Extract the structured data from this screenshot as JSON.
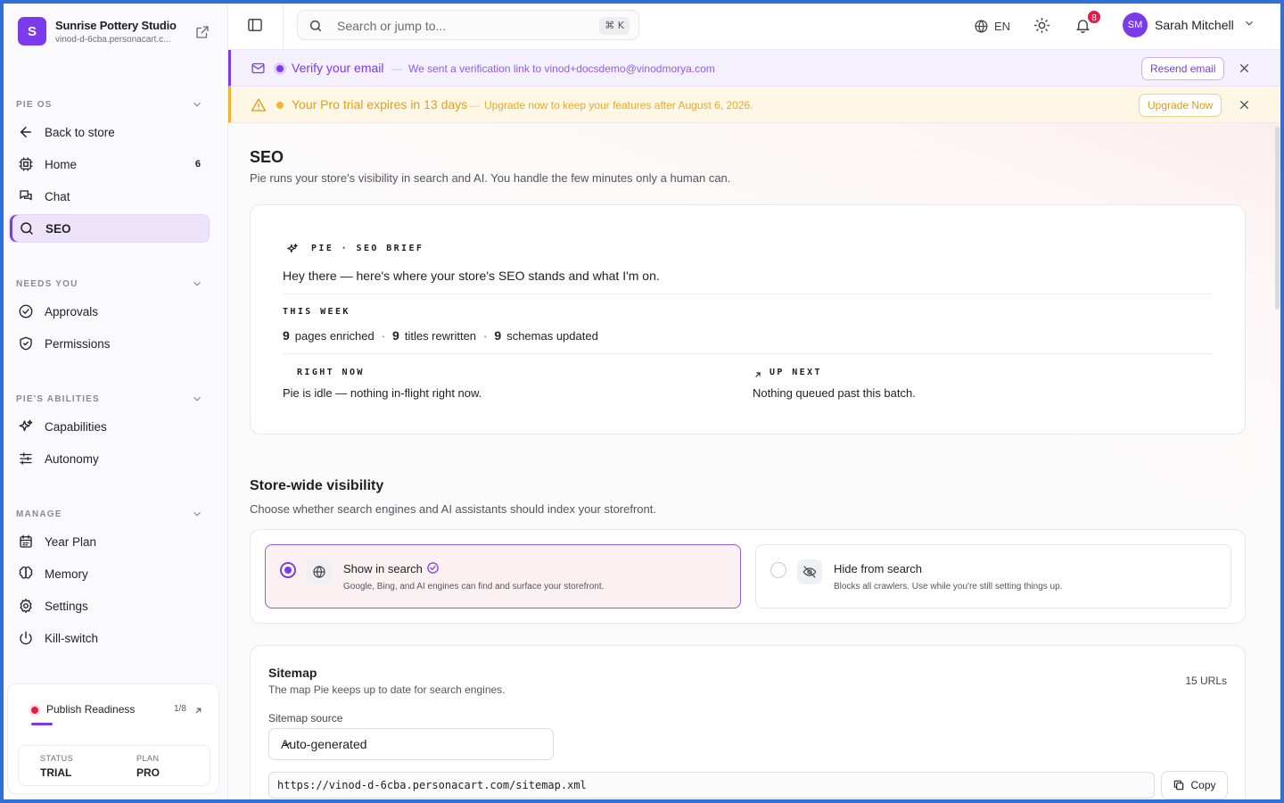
{
  "brand": {
    "initial": "S",
    "name": "Sunrise Pottery Studio",
    "url": "vinod-d-6cba.personacart.c..."
  },
  "sidebar": {
    "sections": [
      {
        "label": "PIE OS"
      },
      {
        "label": "NEEDS YOU"
      },
      {
        "label": "PIE'S ABILITIES"
      },
      {
        "label": "MANAGE"
      }
    ],
    "items": [
      {
        "label": "Back to store",
        "icon": "arrow-left-icon"
      },
      {
        "label": "Home",
        "icon": "cpu-icon",
        "count": "6"
      },
      {
        "label": "Chat",
        "icon": "chat-icon"
      },
      {
        "label": "SEO",
        "icon": "search-icon",
        "active": true
      },
      {
        "label": "Approvals",
        "icon": "check-circle-icon"
      },
      {
        "label": "Permissions",
        "icon": "shield-check-icon"
      },
      {
        "label": "Capabilities",
        "icon": "sparkles-icon"
      },
      {
        "label": "Autonomy",
        "icon": "sliders-icon"
      },
      {
        "label": "Year Plan",
        "icon": "calendar-icon"
      },
      {
        "label": "Memory",
        "icon": "brain-icon"
      },
      {
        "label": "Settings",
        "icon": "gear-icon"
      },
      {
        "label": "Kill-switch",
        "icon": "power-icon"
      }
    ],
    "readiness": {
      "label": "Publish Readiness",
      "count": "1/8",
      "progress": 0.125,
      "status_label": "STATUS",
      "status_value": "TRIAL",
      "plan_label": "PLAN",
      "plan_value": "PRO"
    }
  },
  "topbar": {
    "search_placeholder": "Search or jump to...",
    "shortcut": "⌘ K",
    "language": "EN",
    "notifications": "8",
    "user_initials": "SM",
    "user_name": "Sarah Mitchell"
  },
  "banners": {
    "verify": {
      "title": "Verify your email",
      "dash": "—",
      "message": "We sent a verification link to vinod+docsdemo@vinodmorya.com",
      "button": "Resend email",
      "accent": "#7c3aed"
    },
    "trial": {
      "title": "Your Pro trial expires in 13 days",
      "dash": "—",
      "message": "Upgrade now to keep your features after August 6, 2026.",
      "button": "Upgrade Now",
      "accent": "#f2b531"
    }
  },
  "page": {
    "title": "SEO",
    "subtitle": "Pie runs your store's visibility in search and AI. You handle the few minutes only a human can."
  },
  "brief": {
    "eyebrow": "PIE · SEO BRIEF",
    "greeting": "Hey there — here's where your store's SEO stands and what I'm on.",
    "week_label": "THIS WEEK",
    "stats": [
      {
        "value": "9",
        "label": "pages enriched"
      },
      {
        "value": "9",
        "label": "titles rewritten"
      },
      {
        "value": "9",
        "label": "schemas updated"
      }
    ],
    "separator": "·",
    "right_now_label": "RIGHT NOW",
    "right_now_text": "Pie is idle — nothing in-flight right now.",
    "up_next_label": "UP NEXT",
    "up_next_text": "Nothing queued past this batch."
  },
  "visibility": {
    "title": "Store-wide visibility",
    "subtitle": "Choose whether search engines and AI assistants should index your storefront.",
    "options": [
      {
        "title": "Show in search",
        "desc": "Google, Bing, and AI engines can find and surface your storefront.",
        "selected": true
      },
      {
        "title": "Hide from search",
        "desc": "Blocks all crawlers. Use while you're still setting things up.",
        "selected": false
      }
    ]
  },
  "sitemap": {
    "title": "Sitemap",
    "subtitle": "The map Pie keeps up to date for search engines.",
    "count": "15 URLs",
    "source_label": "Sitemap source",
    "source_value": "Auto-generated",
    "url": "https://vinod-d-6cba.personacart.com/sitemap.xml",
    "copy_label": "Copy"
  }
}
